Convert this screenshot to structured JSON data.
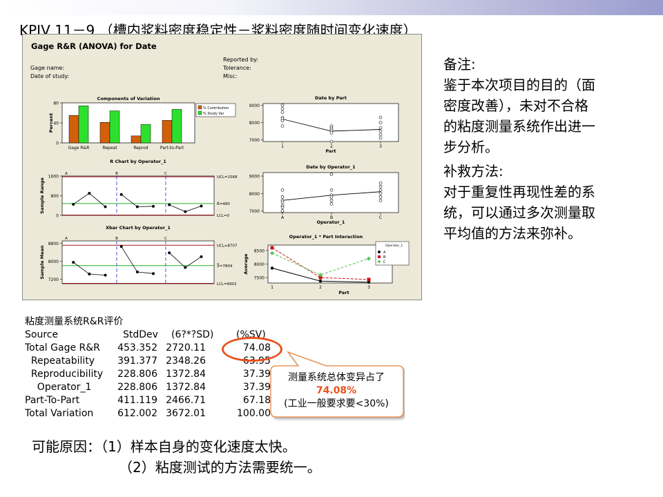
{
  "title": "KPIV 11－9 （槽内浆料密度稳定性－浆料密度随时间变化速度）",
  "minitab": {
    "title": "Gage R&R (ANOVA) for Date",
    "info_left": [
      "Gage name:",
      "Date of study:"
    ],
    "info_right": [
      "Reported by:",
      "Tolerance:",
      "Misc:"
    ]
  },
  "notes": {
    "remark_heading": "备注:",
    "remark_lines": [
      "鉴于本次项目的目的（面",
      "密度改善），未对不合格",
      "的粘度测量系统作出进一",
      "步分析。"
    ],
    "remedy_heading": "补救方法:",
    "remedy_lines": [
      "对于重复性再现性差的系",
      "统，可以通过多次测量取",
      "平均值的方法来弥补。"
    ]
  },
  "rr_table": {
    "heading": "粘度测量系统R&R评价",
    "columns": [
      "Source",
      "StdDev",
      "(6?*?SD)",
      "(%SV)"
    ],
    "rows": [
      [
        "Total Gage R&R",
        "453.352",
        "2720.11",
        "74.08"
      ],
      [
        "  Repeatability",
        "391.377",
        "2348.26",
        "63.95"
      ],
      [
        "  Reproducibility",
        "228.806",
        "1372.84",
        "37.39"
      ],
      [
        "    Operator_1",
        "228.806",
        "1372.84",
        "37.39"
      ],
      [
        "Part-To-Part",
        "411.119",
        "2466.71",
        "67.18"
      ],
      [
        "Total Variation",
        "612.002",
        "3672.01",
        "100.00"
      ]
    ]
  },
  "callout": {
    "line1": "测量系统总体变异占了",
    "line2": "74.08%",
    "line3": "(工业一般要求要<30%)"
  },
  "causes": {
    "line1": "可能原因：（1）样本自身的变化速度太快。",
    "line2": "（2）粘度测试的方法需要统一。"
  },
  "colors": {
    "orange": "#d35f0a",
    "green": "#2ee02e",
    "red_line": "#a01020",
    "callout_border": "#e8521c"
  },
  "chart_data": [
    {
      "type": "bar",
      "title": "Components of Variation",
      "ylabel": "Percent",
      "ylim": [
        0,
        80
      ],
      "yticks": [
        0,
        40,
        80
      ],
      "categories": [
        "Gage R&R",
        "Repeat",
        "Reprod",
        "Part-to-Part"
      ],
      "series": [
        {
          "name": "% Contribution",
          "color": "#d35f0a",
          "values": [
            55,
            41,
            14,
            45
          ]
        },
        {
          "name": "% Study Var",
          "color": "#2ee02e",
          "values": [
            74,
            64,
            37,
            67
          ]
        }
      ],
      "legend_position": "top-right"
    },
    {
      "type": "line",
      "title": "R Chart by Operator_1",
      "ylabel": "Sample Range",
      "ylim": [
        0,
        1600
      ],
      "yticks": [
        0,
        800,
        1600
      ],
      "groups": [
        "A",
        "B",
        "C"
      ],
      "values": [
        450,
        900,
        350,
        850,
        350,
        370,
        430,
        150,
        380
      ],
      "ucl_label": "UCL=1568",
      "center_label": "R̄=480",
      "lcl_label": "LCL=0",
      "ucl": 1568,
      "center": 480,
      "lcl": 0
    },
    {
      "type": "line",
      "title": "Xbar Chart by Operator_1",
      "ylabel": "Sample Mean",
      "ylim": [
        7000,
        8900
      ],
      "yticks": [
        7200,
        8000,
        8800
      ],
      "groups": [
        "A",
        "B",
        "C"
      ],
      "values": [
        7950,
        7430,
        7380,
        8650,
        7520,
        7450,
        8370,
        7720,
        8200
      ],
      "ucl_label": "UCL=8707",
      "center_label": "X̿=7804",
      "lcl_label": "LCL=6902",
      "ucl": 8707,
      "center": 7804,
      "lcl": 6902
    },
    {
      "type": "scatter",
      "title": "Date by Part",
      "xlabel": "Part",
      "ylim": [
        6900,
        9100
      ],
      "yticks": [
        7000,
        8000,
        9000
      ],
      "x_categories": [
        "1",
        "2",
        "3"
      ],
      "points": [
        [
          9000,
          8800,
          8600,
          8300,
          8200,
          8100,
          7800
        ],
        [
          7800,
          7700,
          7600,
          7500,
          7400,
          6900
        ],
        [
          8300,
          8000,
          7700,
          7500,
          7300,
          7100
        ]
      ],
      "means": [
        8200,
        7500,
        7600
      ]
    },
    {
      "type": "scatter",
      "title": "Date by Operator_1",
      "xlabel": "Operator_1",
      "ylim": [
        6900,
        9200
      ],
      "yticks": [
        7000,
        8000,
        9000
      ],
      "x_categories": [
        "A",
        "B",
        "C"
      ],
      "points": [
        [
          8200,
          7800,
          7600,
          7500,
          7300,
          7200,
          7000
        ],
        [
          9100,
          8200,
          7900,
          7800,
          7600,
          7400
        ],
        [
          8600,
          8400,
          8200,
          8000,
          7800,
          7600
        ]
      ],
      "means": [
        7600,
        7900,
        8100
      ]
    },
    {
      "type": "line",
      "title": "Operator_1 * Part Interaction",
      "xlabel": "Part",
      "ylabel": "Average",
      "ylim": [
        7300,
        8700
      ],
      "yticks": [
        7500,
        8000,
        8500
      ],
      "x": [
        "1",
        "2",
        "3"
      ],
      "legend_title": "Operator_1",
      "series": [
        {
          "name": "A",
          "color": "#000000",
          "marker": "circle",
          "values": [
            7850,
            7370,
            7330
          ]
        },
        {
          "name": "B",
          "color": "#cc1111",
          "marker": "square",
          "values": [
            8600,
            7500,
            7430
          ]
        },
        {
          "name": "C",
          "color": "#5fbf5f",
          "marker": "diamond",
          "values": [
            8400,
            7600,
            8200
          ]
        }
      ]
    }
  ]
}
